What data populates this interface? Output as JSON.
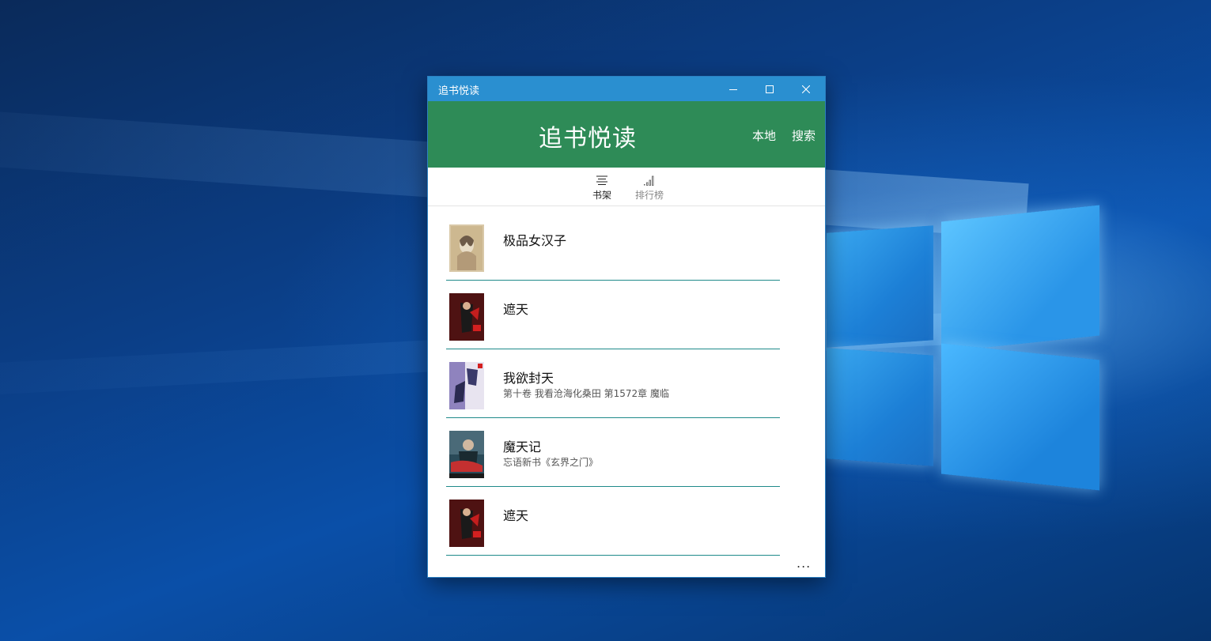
{
  "window": {
    "title": "追书悦读",
    "controls": {
      "minimize": "minimize-icon",
      "maximize": "maximize-icon",
      "close": "close-icon"
    }
  },
  "header": {
    "app_title": "追书悦读",
    "local_label": "本地",
    "search_label": "搜索",
    "color": "#2e8b57"
  },
  "tabs": [
    {
      "label": "书架",
      "icon": "bookshelf-icon",
      "selected": true
    },
    {
      "label": "排行榜",
      "icon": "ranking-icon",
      "selected": false
    }
  ],
  "books": [
    {
      "title": "极品女汉子",
      "subtitle": ""
    },
    {
      "title": "遮天",
      "subtitle": ""
    },
    {
      "title": "我欲封天",
      "subtitle": "第十卷 我看沧海化桑田 第1572章 魔临"
    },
    {
      "title": "魔天记",
      "subtitle": "忘语新书《玄界之门》"
    },
    {
      "title": "遮天",
      "subtitle": ""
    }
  ],
  "more_label": "..."
}
